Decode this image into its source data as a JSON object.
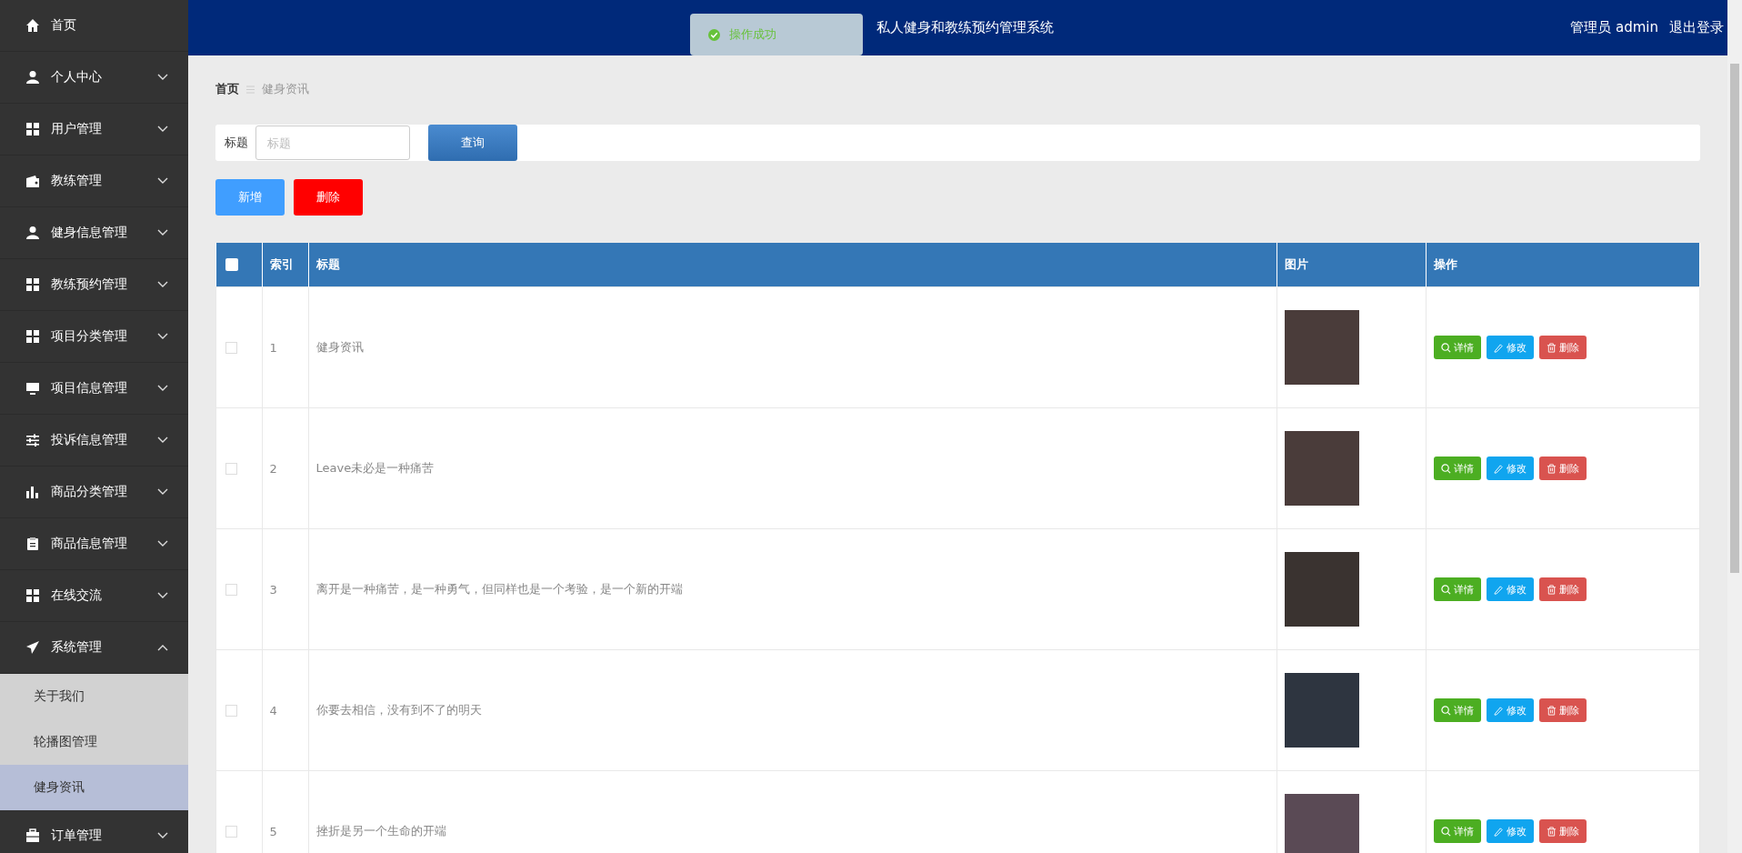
{
  "sidebar": {
    "items": [
      {
        "label": "首页",
        "kind": "link"
      },
      {
        "label": "个人中心",
        "kind": "menu",
        "expanded": false
      },
      {
        "label": "用户管理",
        "kind": "menu",
        "expanded": false
      },
      {
        "label": "教练管理",
        "kind": "menu",
        "expanded": false
      },
      {
        "label": "健身信息管理",
        "kind": "menu",
        "expanded": false
      },
      {
        "label": "教练预约管理",
        "kind": "menu",
        "expanded": false
      },
      {
        "label": "项目分类管理",
        "kind": "menu",
        "expanded": false
      },
      {
        "label": "项目信息管理",
        "kind": "menu",
        "expanded": false
      },
      {
        "label": "投诉信息管理",
        "kind": "menu",
        "expanded": false
      },
      {
        "label": "商品分类管理",
        "kind": "menu",
        "expanded": false
      },
      {
        "label": "商品信息管理",
        "kind": "menu",
        "expanded": false
      },
      {
        "label": "在线交流",
        "kind": "menu",
        "expanded": false
      },
      {
        "label": "系统管理",
        "kind": "menu",
        "expanded": true,
        "children": [
          {
            "label": "关于我们",
            "selected": false
          },
          {
            "label": "轮播图管理",
            "selected": false
          },
          {
            "label": "健身资讯",
            "selected": true
          }
        ]
      },
      {
        "label": "订单管理",
        "kind": "menu",
        "expanded": false
      }
    ]
  },
  "header": {
    "title": "私人健身和教练预约管理系统",
    "user": "管理员 admin",
    "logout": "退出登录"
  },
  "toast": {
    "message": "操作成功"
  },
  "breadcrumb": [
    "首页",
    "健身资讯"
  ],
  "search": {
    "label": "标题",
    "placeholder": "标题",
    "button": "查询"
  },
  "actions": {
    "add": "新增",
    "delete": "删除"
  },
  "table": {
    "header_checked": false,
    "columns": [
      "索引",
      "标题",
      "图片",
      "操作"
    ],
    "rows": [
      {
        "checked": false,
        "index": "1",
        "title": "健身资讯",
        "buttons": [
          "详情",
          "修改",
          "删除"
        ]
      },
      {
        "checked": false,
        "index": "2",
        "title": "Leave未必是一种痛苦",
        "buttons": [
          "详情",
          "修改",
          "删除"
        ]
      },
      {
        "checked": false,
        "index": "3",
        "title": "离开是一种痛苦，是一种勇气，但同样也是一个考验，是一个新的开端",
        "buttons": [
          "详情",
          "修改",
          "删除"
        ]
      },
      {
        "checked": false,
        "index": "4",
        "title": "你要去相信，没有到不了的明天",
        "buttons": [
          "详情",
          "修改",
          "删除"
        ]
      },
      {
        "checked": false,
        "index": "5",
        "title": "挫折是另一个生命的开端",
        "buttons": [
          "详情",
          "修改",
          "删除"
        ]
      }
    ]
  }
}
